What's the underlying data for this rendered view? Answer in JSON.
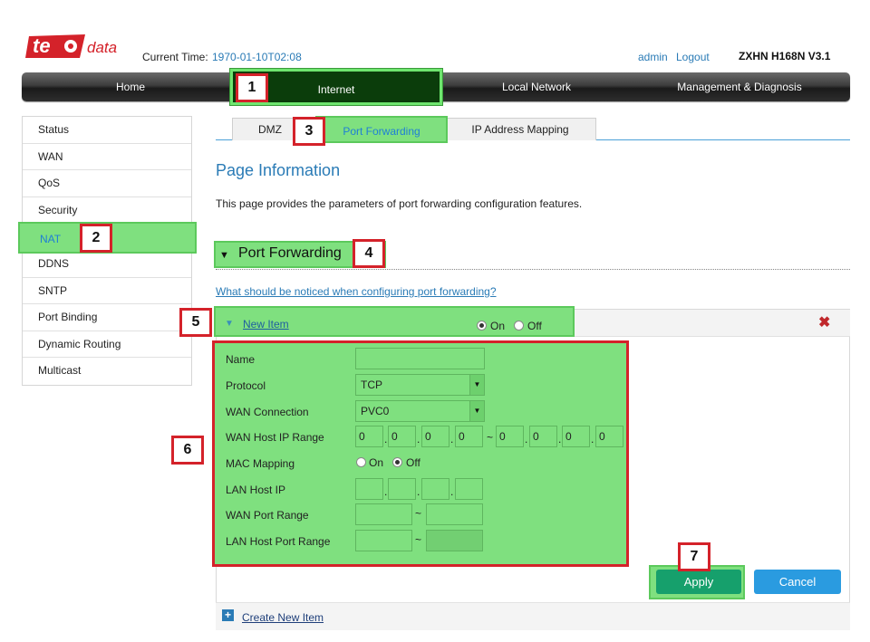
{
  "header": {
    "logo_text_1": "te",
    "logo_text_2": "data",
    "current_time_label": "Current Time:",
    "current_time_value": "1970-01-10T02:08",
    "admin": "admin",
    "logout": "Logout",
    "model": "ZXHN H168N V3.1"
  },
  "nav": {
    "items": [
      "Home",
      "Internet",
      "Local Network",
      "Management & Diagnosis"
    ],
    "active": "Internet"
  },
  "sidebar": {
    "items": [
      "Status",
      "WAN",
      "QoS",
      "Security",
      "NAT",
      "DDNS",
      "SNTP",
      "Port Binding",
      "Dynamic Routing",
      "Multicast"
    ],
    "active": "NAT"
  },
  "tabs": {
    "items": [
      "DMZ",
      "Port Forwarding",
      "IP Address Mapping"
    ],
    "active": "Port Forwarding"
  },
  "main": {
    "page_title": "Page Information",
    "page_desc": "This page provides the parameters of port forwarding configuration features.",
    "section_title": "Port Forwarding",
    "help_link": "What should be noticed when configuring port forwarding?"
  },
  "item": {
    "name": "New Item",
    "on_label": "On",
    "off_label": "Off",
    "state": "On"
  },
  "form": {
    "labels": [
      "Name",
      "Protocol",
      "WAN Connection",
      "WAN Host IP Range",
      "MAC Mapping",
      "LAN Host IP",
      "WAN Port Range",
      "LAN Host Port Range"
    ],
    "name_value": "",
    "protocol_value": "TCP",
    "wan_connection_value": "PVC0",
    "wan_ip_start": [
      "0",
      "0",
      "0",
      "0"
    ],
    "wan_ip_end": [
      "0",
      "0",
      "0",
      "0"
    ],
    "range_sep": "~",
    "mac_on_label": "On",
    "mac_off_label": "Off",
    "mac_mapping": "Off"
  },
  "buttons": {
    "apply": "Apply",
    "cancel": "Cancel",
    "create_new_item": "Create New Item"
  },
  "annotations": [
    "1",
    "2",
    "3",
    "4",
    "5",
    "6",
    "7"
  ],
  "colors": {
    "highlight": "#7fe07f",
    "annotation_border": "#d4222a",
    "link": "#2a7bb6",
    "apply": "#16a06c",
    "cancel": "#2a9be0"
  }
}
